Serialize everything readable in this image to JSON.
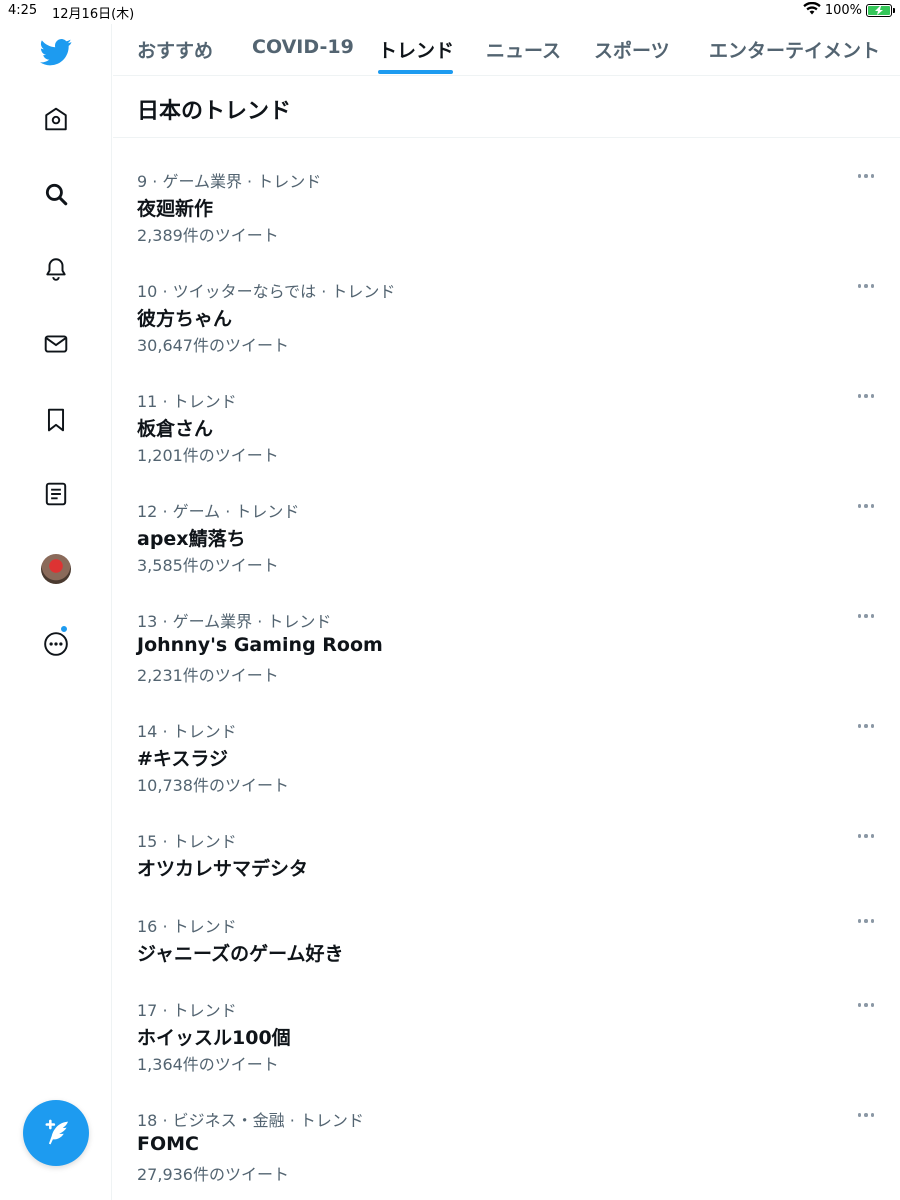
{
  "status_bar": {
    "time": "4:25",
    "date": "12月16日(木)",
    "battery": "100%"
  },
  "sidebar": {
    "items": [
      {
        "name": "twitter-logo-icon"
      },
      {
        "name": "home-icon"
      },
      {
        "name": "search-icon"
      },
      {
        "name": "notifications-icon"
      },
      {
        "name": "messages-icon"
      },
      {
        "name": "bookmarks-icon"
      },
      {
        "name": "lists-icon"
      },
      {
        "name": "profile-avatar"
      },
      {
        "name": "more-icon"
      }
    ],
    "compose": "compose-tweet-icon"
  },
  "tabs": [
    {
      "label": "おすすめ"
    },
    {
      "label": "COVID-19"
    },
    {
      "label": "トレンド",
      "active": true
    },
    {
      "label": "ニュース"
    },
    {
      "label": "スポーツ"
    },
    {
      "label": "エンターテイメント"
    }
  ],
  "section": {
    "title": "日本のトレンド"
  },
  "trends": [
    {
      "meta": "9 · ゲーム業界 · トレンド",
      "name": "夜廻新作",
      "count": "2,389件のツイート"
    },
    {
      "meta": "10 · ツイッターならでは · トレンド",
      "name": "彼方ちゃん",
      "count": "30,647件のツイート"
    },
    {
      "meta": "11 · トレンド",
      "name": "板倉さん",
      "count": "1,201件のツイート"
    },
    {
      "meta": "12 · ゲーム · トレンド",
      "name": "apex鯖落ち",
      "count": "3,585件のツイート"
    },
    {
      "meta": "13 · ゲーム業界 · トレンド",
      "name": "Johnny's Gaming Room",
      "count": "2,231件のツイート"
    },
    {
      "meta": "14 · トレンド",
      "name": "#キスラジ",
      "count": "10,738件のツイート"
    },
    {
      "meta": "15 · トレンド",
      "name": "オツカレサマデシタ",
      "count": ""
    },
    {
      "meta": "16 · トレンド",
      "name": "ジャニーズのゲーム好き",
      "count": ""
    },
    {
      "meta": "17 · トレンド",
      "name": "ホイッスル100個",
      "count": "1,364件のツイート"
    },
    {
      "meta": "18 · ビジネス・金融 · トレンド",
      "name": "FOMC",
      "count": "27,936件のツイート"
    }
  ],
  "colors": {
    "accent": "#1d9bf0",
    "text": "#0f1419",
    "secondary": "#536471"
  }
}
